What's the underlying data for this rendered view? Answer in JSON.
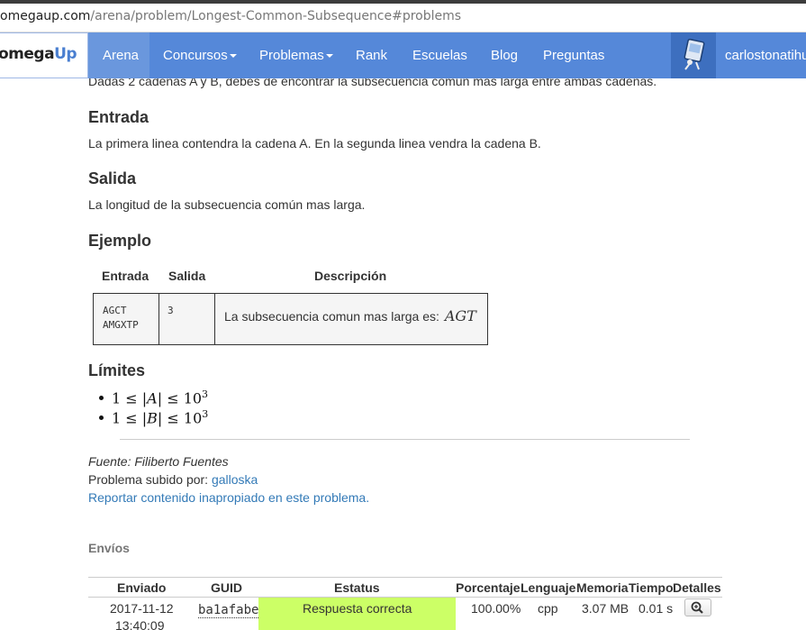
{
  "browser": {
    "url_host": "omegaup.com",
    "url_path": "/arena/problem/Longest-Common-Subsequence#problems"
  },
  "nav": {
    "brand_a": "omega",
    "brand_b": "Up",
    "items": [
      "Arena",
      "Concursos",
      "Problemas",
      "Rank",
      "Escuelas",
      "Blog",
      "Preguntas"
    ],
    "username": "carlostonatihu"
  },
  "problem": {
    "intro": "Dadas 2 cadenas A y B, debes de encontrar la subsecuencia común mas larga entre ambas cadenas.",
    "entrada_title": "Entrada",
    "entrada_text": "La primera linea contendra la cadena A. En la segunda linea vendra la cadena B.",
    "salida_title": "Salida",
    "salida_text": "La longitud de la subsecuencia común mas larga.",
    "ejemplo_title": "Ejemplo",
    "example": {
      "headers": [
        "Entrada",
        "Salida",
        "Descripción"
      ],
      "input_lines": [
        "AGCT",
        "AMGXTP"
      ],
      "output": "3",
      "description": "La subsecuencia comun mas larga es:",
      "description_math": "AGT"
    },
    "limites_title": "Límites",
    "limits": [
      {
        "left": "1 ≤ |",
        "var": "A",
        "right": "| ≤ 10",
        "exp": "3"
      },
      {
        "left": "1 ≤ |",
        "var": "B",
        "right": "| ≤ 10",
        "exp": "3"
      }
    ],
    "source": "Fuente: Filiberto Fuentes",
    "uploaded_label": "Problema subido por:",
    "uploaded_user": "galloska",
    "report_link": "Reportar contenido inapropiado en este problema."
  },
  "submissions": {
    "title": "Envíos",
    "headers": [
      "Enviado",
      "GUID",
      "Estatus",
      "Porcentaje",
      "Lenguaje",
      "Memoria",
      "Tiempo",
      "Detalles"
    ],
    "rows": [
      {
        "date": "2017-11-12",
        "time": "13:40:09",
        "guid": "ba1afabe",
        "status": "Respuesta correcta",
        "percent": "100.00%",
        "language": "cpp",
        "memory": "3.07 MB",
        "runtime": "0.01 s"
      }
    ]
  },
  "colors": {
    "navbar": "#5588d9",
    "accepted": "#ccff66",
    "link": "#337ab7"
  }
}
